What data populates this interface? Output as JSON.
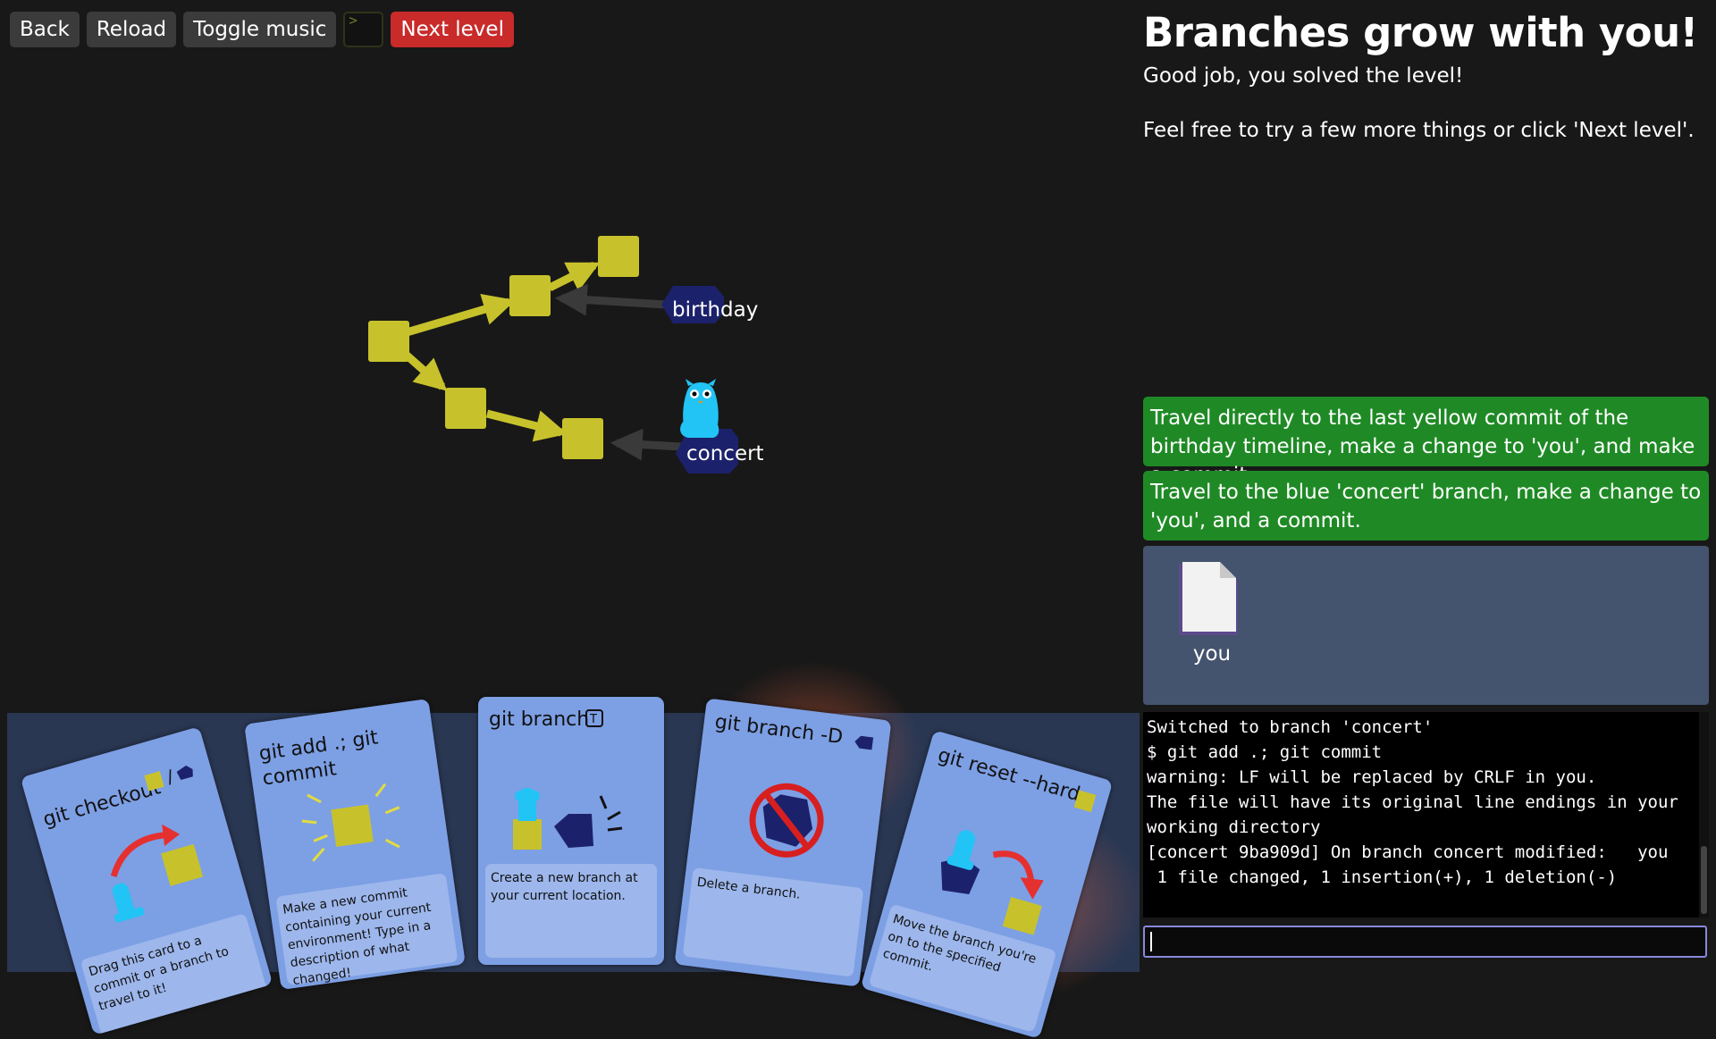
{
  "toolbar": {
    "back": "Back",
    "reload": "Reload",
    "toggle_music": "Toggle music",
    "terminal_glyph": ">",
    "next_level": "Next level"
  },
  "level": {
    "title": "Branches grow with you!",
    "line1": "Good job, you solved the level!",
    "line2": "Feel free to try a few more things or click 'Next level'."
  },
  "graph": {
    "branch_birthday": "birthday",
    "branch_concert": "concert"
  },
  "tasks": [
    "Travel directly to the last yellow commit of the birthday timeline, make a change to 'you', and make a commit",
    "Travel to the blue 'concert' branch, make a change to 'you', and a commit."
  ],
  "files": [
    {
      "name": "you"
    }
  ],
  "terminal": {
    "lines": [
      "Switched to branch 'concert'",
      "$ git add .; git commit",
      "warning: LF will be replaced by CRLF in you.",
      "The file will have its original line endings in your",
      "working directory",
      "[concert 9ba909d] On branch concert modified:   you",
      " 1 file changed, 1 insertion(+), 1 deletion(-)"
    ],
    "input_value": ""
  },
  "cards": [
    {
      "title": "git checkout",
      "desc": "Drag this card to a commit or a branch to travel to it!"
    },
    {
      "title": "git add .; git commit",
      "desc": "Make a new commit containing your current environment! Type in a description of what changed!"
    },
    {
      "title": "git branch",
      "desc": "Create a new branch at your current location."
    },
    {
      "title": "git branch -D",
      "desc": "Delete a branch."
    },
    {
      "title": "git reset --hard",
      "desc": "Move the branch you're on to the specified commit."
    }
  ],
  "colors": {
    "commit": "#c7c22c",
    "branch": "#1c216b",
    "task_done": "#1f8a25",
    "card": "#7d9fe4",
    "next_level": "#c92a2a"
  },
  "icons": [
    "terminal-icon",
    "file-icon",
    "player-blob-icon",
    "branch-tag-icon",
    "arrow-icon",
    "no-entry-icon",
    "keyboard-key-icon"
  ]
}
